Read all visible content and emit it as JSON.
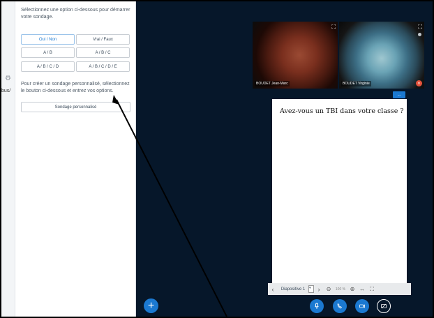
{
  "sidebar": {
    "cut_text": "bus/"
  },
  "poll_panel": {
    "intro": "Sélectionnez une option ci-dessous pour démarrer votre sondage.",
    "options": [
      "Oui / Non",
      "Vrai / Faux",
      "A / B",
      "A / B / C",
      "A / B / C / D",
      "A / B / C / D / E"
    ],
    "custom_text": "Pour créer un sondage personnalisé, sélectionnez le bouton ci-dessous et entrez vos options.",
    "custom_button": "Sondage personnalisé"
  },
  "videos": [
    {
      "name": "BOUDET Jean-Marc"
    },
    {
      "name": "BOUDET Virginie"
    }
  ],
  "slide": {
    "question": "Avez-vous un TBI dans votre classe ?",
    "menu_button": "..."
  },
  "slide_toolbar": {
    "prev": "‹",
    "slide_label": "Diapositive 1",
    "dropdown": "▾",
    "next": "›",
    "zoom_out": "⊖",
    "zoom_level": "100 %",
    "zoom_in": "⊕",
    "fit_width": "↔",
    "fullscreen": "⛶"
  },
  "actions": {
    "plus": "+"
  },
  "colors": {
    "accent": "#1b79d1",
    "stage_bg": "#06172a"
  }
}
